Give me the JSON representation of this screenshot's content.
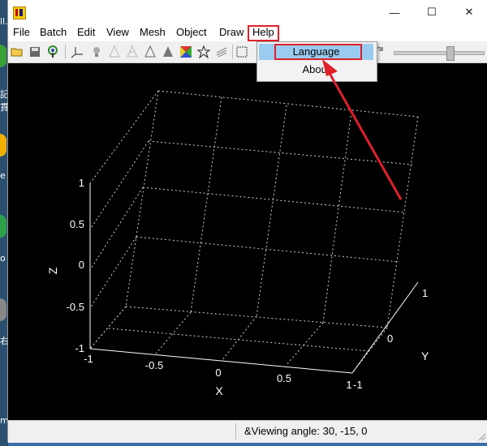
{
  "window": {
    "title": "",
    "controls": {
      "minimize": "—",
      "maximize": "☐",
      "close": "✕"
    }
  },
  "desktop_fragments": [
    "ll.",
    "記",
    "貫",
    "e",
    "o",
    "右",
    "m"
  ],
  "menubar": {
    "items": [
      "File",
      "Batch",
      "Edit",
      "View",
      "Mesh",
      "Object",
      "Draw",
      "Help"
    ],
    "highlighted": "Help"
  },
  "help_menu": {
    "items": [
      "Language",
      "About"
    ],
    "selected": "Language"
  },
  "toolbar": {
    "buttons": [
      "open-icon",
      "save-icon",
      "network-icon",
      "axes-icon",
      "light-icon",
      "cone-wire-icon",
      "cone-grid-icon",
      "cone-outline-icon",
      "cone-solid-icon",
      "color-cube-icon",
      "star-icon",
      "texture-icon",
      "select-box-icon"
    ]
  },
  "plot": {
    "z_label": "Z",
    "x_label": "X",
    "y_label": "Y",
    "z_ticks": [
      "1",
      "0.5",
      "0",
      "-0.5",
      "-1"
    ],
    "x_ticks": [
      "-1",
      "-0.5",
      "0",
      "0.5",
      "1"
    ],
    "y_ticks": [
      "-1",
      "0",
      "1"
    ],
    "colors": {
      "background": "#000000",
      "axes": "#ffffff",
      "grid": "#cccccc",
      "annotation": "#e0202a"
    }
  },
  "statusbar": {
    "text": "&Viewing angle: 30, -15, 0"
  }
}
